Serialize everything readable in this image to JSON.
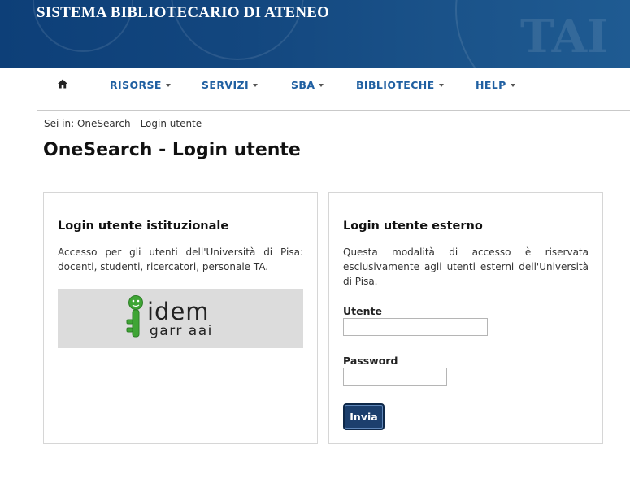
{
  "header": {
    "title": "SISTEMA BIBLIOTECARIO DI ATENEO"
  },
  "nav": {
    "home_icon": "home-icon",
    "items": [
      {
        "label": "RISORSE"
      },
      {
        "label": "SERVIZI"
      },
      {
        "label": "SBA"
      },
      {
        "label": "BIBLIOTECHE"
      },
      {
        "label": "HELP"
      }
    ]
  },
  "breadcrumb": "Sei in: OneSearch - Login utente",
  "page_title": "OneSearch - Login utente",
  "institutional": {
    "heading": "Login utente istituzionale",
    "description": "Accesso per gli utenti dell'Università di Pisa: docenti, studenti, ricercatori, personale TA.",
    "logo": {
      "word": "idem",
      "subtitle": "garr aai"
    }
  },
  "external": {
    "heading": "Login utente esterno",
    "description": "Questa modalità di accesso è riservata esclusivamente agli utenti esterni dell'Università di Pisa.",
    "username_label": "Utente",
    "username_value": "",
    "password_label": "Password",
    "password_value": "",
    "submit_label": "Invia"
  },
  "colors": {
    "banner": "#13477f",
    "nav_link": "#1f5fa1",
    "button": "#1c3f6d",
    "idem_green": "#3fa535"
  }
}
